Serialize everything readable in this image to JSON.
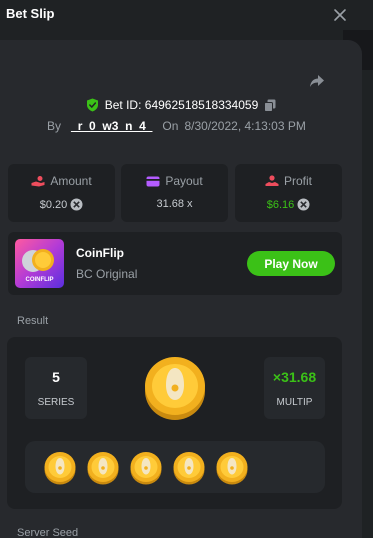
{
  "header": {
    "title": "Bet Slip"
  },
  "bet": {
    "id_label": "Bet ID:",
    "id_value": "64962518518334059",
    "by_label": "By",
    "username": "_r_0_w3_n_4_",
    "on_label": "On",
    "datetime": "8/30/2022, 4:13:03 PM"
  },
  "stats": {
    "amount": {
      "label": "Amount",
      "value": "$0.20"
    },
    "payout": {
      "label": "Payout",
      "value": "31.68 x"
    },
    "profit": {
      "label": "Profit",
      "value": "$6.16"
    }
  },
  "game": {
    "thumb_label": "COINFLIP",
    "name": "CoinFlip",
    "subtitle": "BC Original",
    "play_label": "Play Now"
  },
  "result": {
    "section_label": "Result",
    "series_value": "5",
    "series_label": "SERIES",
    "multiplier_value": "×31.68",
    "multiplier_label": "MULTIP",
    "coin_count": 5
  },
  "server_seed": {
    "label": "Server Seed"
  },
  "colors": {
    "accent_green": "#3bc117",
    "coin_gold": "#f2b01e",
    "panel": "#27292d",
    "card": "#1e2023"
  },
  "icons": [
    "close-icon",
    "share-icon",
    "shield-check-icon",
    "copy-icon",
    "amount-icon",
    "payout-icon",
    "profit-icon",
    "coin-icon"
  ]
}
